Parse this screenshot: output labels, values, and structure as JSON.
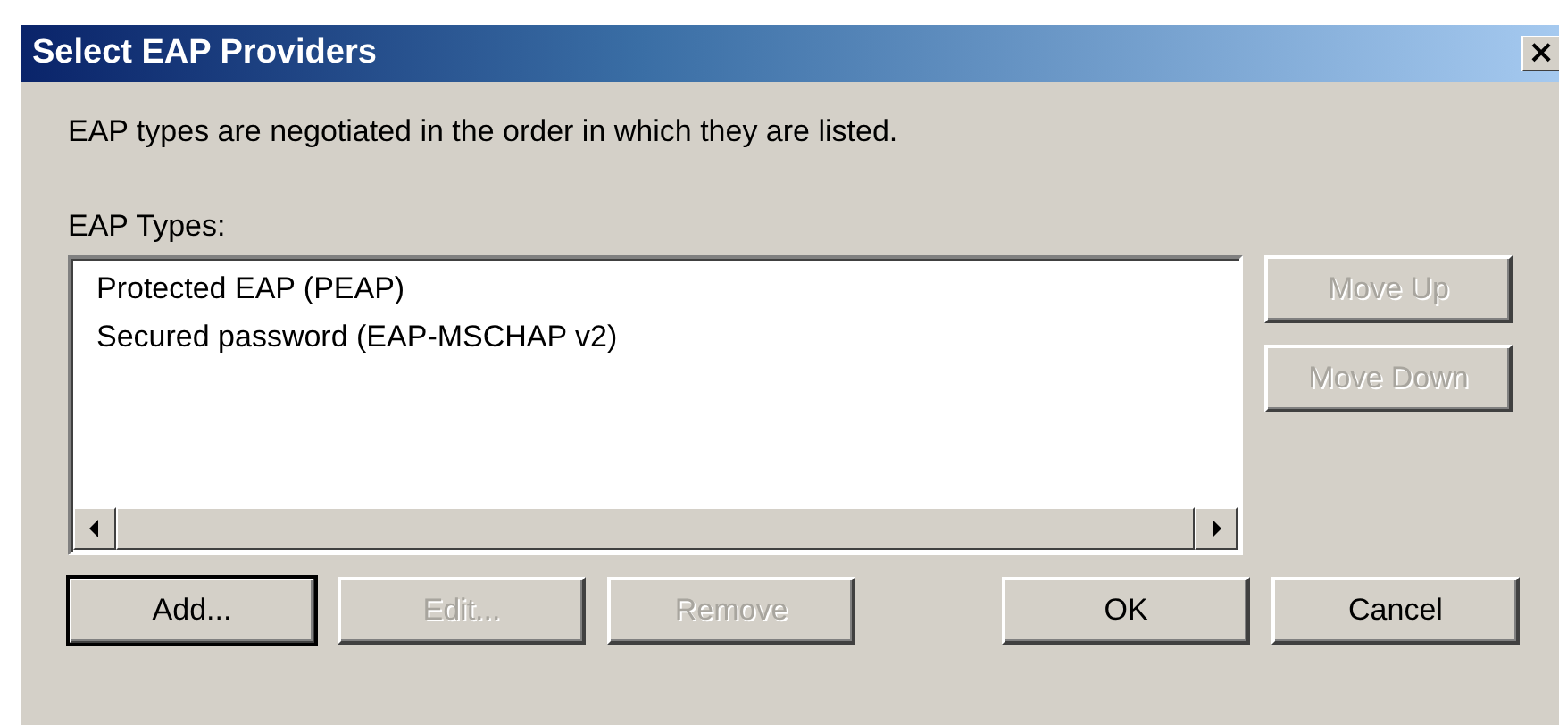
{
  "window": {
    "title": "Select EAP Providers",
    "close": "×"
  },
  "description": "EAP types are negotiated in the order in which they are listed.",
  "list_label": "EAP Types:",
  "eap_types": [
    {
      "label": "Protected EAP (PEAP)",
      "selected": false
    },
    {
      "label": "Secured password (EAP-MSCHAP v2)",
      "selected": false
    }
  ],
  "side_buttons": [
    {
      "label": "Move Up",
      "disabled": true,
      "default": false
    },
    {
      "label": "Move Down",
      "disabled": true,
      "default": false
    }
  ],
  "bottom_buttons": [
    {
      "label": "Add...",
      "disabled": false,
      "default": true
    },
    {
      "label": "Edit...",
      "disabled": true,
      "default": false
    },
    {
      "label": "Remove",
      "disabled": true,
      "default": false
    },
    {
      "label": "OK",
      "disabled": false,
      "default": false
    },
    {
      "label": "Cancel",
      "disabled": false,
      "default": false
    }
  ]
}
